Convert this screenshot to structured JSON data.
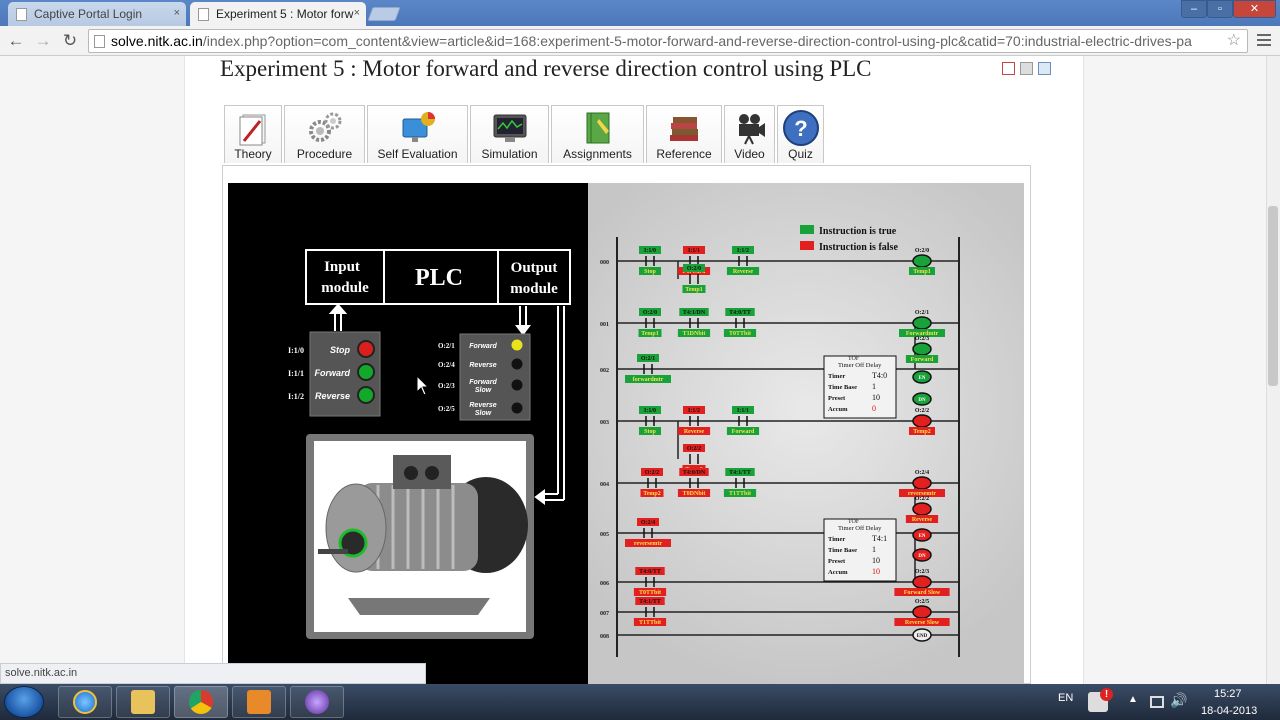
{
  "browser": {
    "tabs": [
      {
        "title": "Captive Portal Login",
        "close": "×",
        "active": false
      },
      {
        "title": "Experiment 5 : Motor forw",
        "close": "×",
        "active": true
      }
    ],
    "window_buttons": [
      "–",
      "▫",
      "✕"
    ],
    "url_host": "solve.nitk.ac.in",
    "url_rest": "/index.php?option=com_content&view=article&id=168:experiment-5-motor-forward-and-reverse-direction-control-using-plc&catid=70:industrial-electric-drives-pa",
    "status_url": "solve.nitk.ac.in"
  },
  "page": {
    "title": "Experiment 5 : Motor forward and reverse direction control using PLC",
    "tabs": [
      "Theory",
      "Procedure",
      "Self Evaluation",
      "Simulation",
      "Assignments",
      "Reference",
      "Video",
      "Quiz"
    ]
  },
  "sim": {
    "plc_input": "Input\nmodule",
    "plc_label": "PLC",
    "plc_output": "Output\nmodule",
    "inputs": [
      {
        "addr": "I:1/0",
        "name": "Stop",
        "color": "#d9201e"
      },
      {
        "addr": "I:1/1",
        "name": "Forward",
        "color": "#12a82a"
      },
      {
        "addr": "I:1/2",
        "name": "Reverse",
        "color": "#12a82a"
      }
    ],
    "outputs": [
      {
        "addr": "O:2/1",
        "name": "Forward",
        "color": "#e8e21b"
      },
      {
        "addr": "O:2/4",
        "name": "Reverse",
        "color": "#111111"
      },
      {
        "addr": "O:2/3",
        "name": "Forward Slow",
        "color": "#111111"
      },
      {
        "addr": "O:2/5",
        "name": "Reverse Slow",
        "color": "#111111"
      }
    ],
    "legend_true": "Instruction is true",
    "legend_false": "Instruction is false",
    "color_true": "#19a23a",
    "color_false": "#e32020",
    "rung_numbers": [
      "000",
      "001",
      "002",
      "003",
      "004",
      "005",
      "006",
      "007",
      "008"
    ],
    "timers": [
      {
        "type": "TOF",
        "title": "Timer Off Delay",
        "timer_label": "Timer",
        "timer": "T4:0",
        "base_label": "Time Base",
        "base": "1",
        "preset_label": "Preset",
        "preset": "10",
        "accum_label": "Accum",
        "accum": "0"
      },
      {
        "type": "TOF",
        "title": "Timer Off Delay",
        "timer_label": "Timer",
        "timer": "T4:1",
        "base_label": "Time Base",
        "base": "1",
        "preset_label": "Preset",
        "preset": "10",
        "accum_label": "Accum",
        "accum": "10"
      }
    ],
    "contacts": [
      {
        "top": "I:1/0",
        "name": "Stop",
        "state": "true"
      },
      {
        "top": "I:1/1",
        "name": "Forward",
        "state": "false"
      },
      {
        "top": "I:1/2",
        "name": "Reverse",
        "state": "true"
      },
      {
        "top": "O:2/0",
        "name": "Temp1",
        "state": "true"
      },
      {
        "top": "O:2/0",
        "name": "Temp1",
        "state": "true"
      },
      {
        "top": "T4:1/DN",
        "name": "T1DNbit",
        "state": "true"
      },
      {
        "top": "T4:0/TT",
        "name": "T0TTbit",
        "state": "true"
      },
      {
        "top": "O:2/1",
        "name": "forwardmtr",
        "state": "true"
      },
      {
        "top": "I:1/0",
        "name": "Stop",
        "state": "true"
      },
      {
        "top": "I:1/2",
        "name": "Reverse",
        "state": "false"
      },
      {
        "top": "I:1/1",
        "name": "Forward",
        "state": "true"
      },
      {
        "top": "O:2/2",
        "name": "Temp2",
        "state": "false"
      },
      {
        "top": "O:2/2",
        "name": "Temp2",
        "state": "false"
      },
      {
        "top": "T4:0/DN",
        "name": "T0DNbit",
        "state": "false"
      },
      {
        "top": "T4:1/TT",
        "name": "T1TTbit",
        "state": "true"
      },
      {
        "top": "O:2/4",
        "name": "reversemtr",
        "state": "false"
      },
      {
        "top": "T4:0/TT",
        "name": "T0TTbit",
        "state": "false"
      },
      {
        "top": "T4:1/TT",
        "name": "T1TTbit",
        "state": "false"
      }
    ],
    "coils": [
      {
        "top": "O:2/0",
        "name": "Temp1",
        "state": "true"
      },
      {
        "top": "O:2/1",
        "name": "Forwardmtr",
        "state": "true"
      },
      {
        "top": "O:2/3",
        "name": "Forward",
        "state": "true"
      },
      {
        "top": "",
        "name": "EN",
        "state": "true"
      },
      {
        "top": "",
        "name": "DN",
        "state": "true"
      },
      {
        "top": "O:2/2",
        "name": "Temp2",
        "state": "false"
      },
      {
        "top": "O:2/4",
        "name": "reversemtr",
        "state": "false"
      },
      {
        "top": "O:2/2",
        "name": "Reverse",
        "state": "false"
      },
      {
        "top": "",
        "name": "EN",
        "state": "false"
      },
      {
        "top": "",
        "name": "DN",
        "state": "false"
      },
      {
        "top": "O:2/3",
        "name": "Forward Slow",
        "state": "false"
      },
      {
        "top": "O:2/5",
        "name": "Reverse Slow",
        "state": "false"
      },
      {
        "top": "",
        "name": "END",
        "state": "none"
      }
    ]
  },
  "taskbar": {
    "lang": "EN",
    "time": "15:27",
    "date": "18-04-2013"
  }
}
